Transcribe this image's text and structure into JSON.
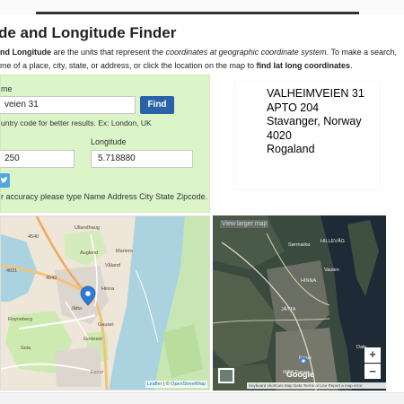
{
  "header": {
    "title": "de and Longitude Finder"
  },
  "description": {
    "line1_bold": "nd Longitude",
    "line1_text": " are the units that represent the ",
    "line1_italic": "coordinates at geographic coordinate system",
    "line1_tail": ". To make a search,",
    "line2_text": "me of a place, city, state, or address, or click the location on the map to ",
    "line2_bold": "find lat long coordinates",
    "line2_tail": "."
  },
  "form": {
    "place_label": "me",
    "place_value": "veien 31",
    "find_label": "Find",
    "hint": "untry code for better results. Ex: London, UK",
    "latitude_label": "",
    "latitude_value": "250",
    "longitude_label": "Longitude",
    "longitude_value": "5.718880",
    "accuracy_note": "r accuracy please type Name Address City State Zipcode."
  },
  "address": {
    "line1": "VALHEIMVEIEN 31",
    "line2": "APTO 204",
    "line3": "Stavanger, Norway",
    "line4": "4020",
    "line5": "Rogaland"
  },
  "map_left": {
    "labels": [
      "Ullandhaug",
      "4540",
      "Auglend",
      "Mariero",
      "Våland",
      "Hinna",
      "Jåtta",
      "Gausel",
      "Godeset",
      "Royneberg",
      "Forus",
      "Sola",
      "4043",
      "4031"
    ],
    "attribution_link": "Leaflet",
    "attribution_sep": " | © ",
    "attribution_osm": "OpenStreetMap"
  },
  "map_right": {
    "view_larger": "View larger map",
    "labels": [
      "HILLEVÅG",
      "Sørmarka",
      "Vaulen",
      "HINNA",
      "JÅTTA",
      "Dale",
      "Forus",
      "IKEA Forus"
    ],
    "google": "Google",
    "attribution": "Keyboard shortcuts   Map Data   Terms of Use   Report a map error",
    "zoom_in": "+",
    "zoom_out": "−"
  },
  "colors": {
    "form_bg": "#dcf5c8",
    "find_button": "#2a62a8",
    "twitter": "#4ca7e3"
  }
}
